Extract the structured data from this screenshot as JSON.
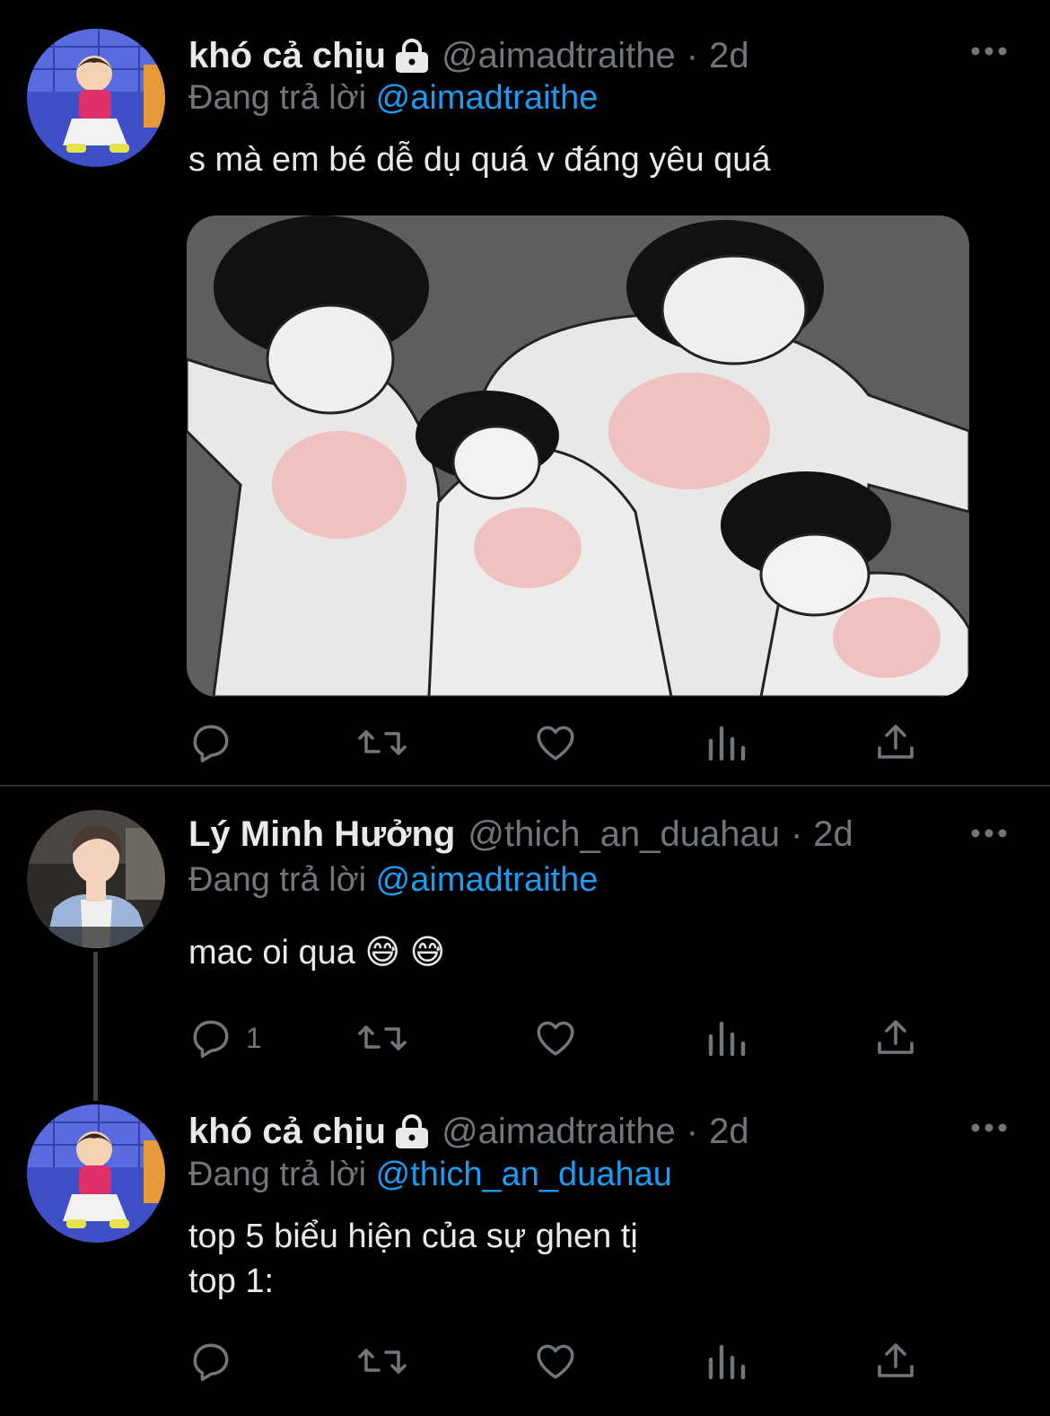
{
  "tweets": [
    {
      "name": "khó cả chịu",
      "handle": "@aimadtraithe",
      "time": "2d",
      "replying_label": "Đang trả lời",
      "replying_to": "@aimadtraithe",
      "text": "s mà em bé dễ dụ quá v đáng yêu quá",
      "has_media": true,
      "reply_count": ""
    },
    {
      "name": "Lý Minh Hưởng",
      "handle": "@thich_an_duahau",
      "time": "2d",
      "replying_label": "Đang trả lời",
      "replying_to": "@aimadtraithe",
      "text": "mac oi qua 😅 😅",
      "has_media": false,
      "reply_count": "1"
    },
    {
      "name": "khó cả chịu",
      "handle": "@aimadtraithe",
      "time": "2d",
      "replying_label": "Đang trả lời",
      "replying_to": "@thich_an_duahau",
      "text_lines": [
        "top 5 biểu hiện của sự ghen tị",
        "top 1:"
      ],
      "has_media": false,
      "reply_count": ""
    }
  ],
  "separator": "·",
  "colors": {
    "background": "#000000",
    "text": "#e7e9ea",
    "muted": "#71767b",
    "link": "#1d9bf0",
    "divider": "#2f3336"
  },
  "icons": [
    "lock-icon",
    "more-icon",
    "reply-icon",
    "retweet-icon",
    "like-icon",
    "views-icon",
    "share-icon"
  ]
}
